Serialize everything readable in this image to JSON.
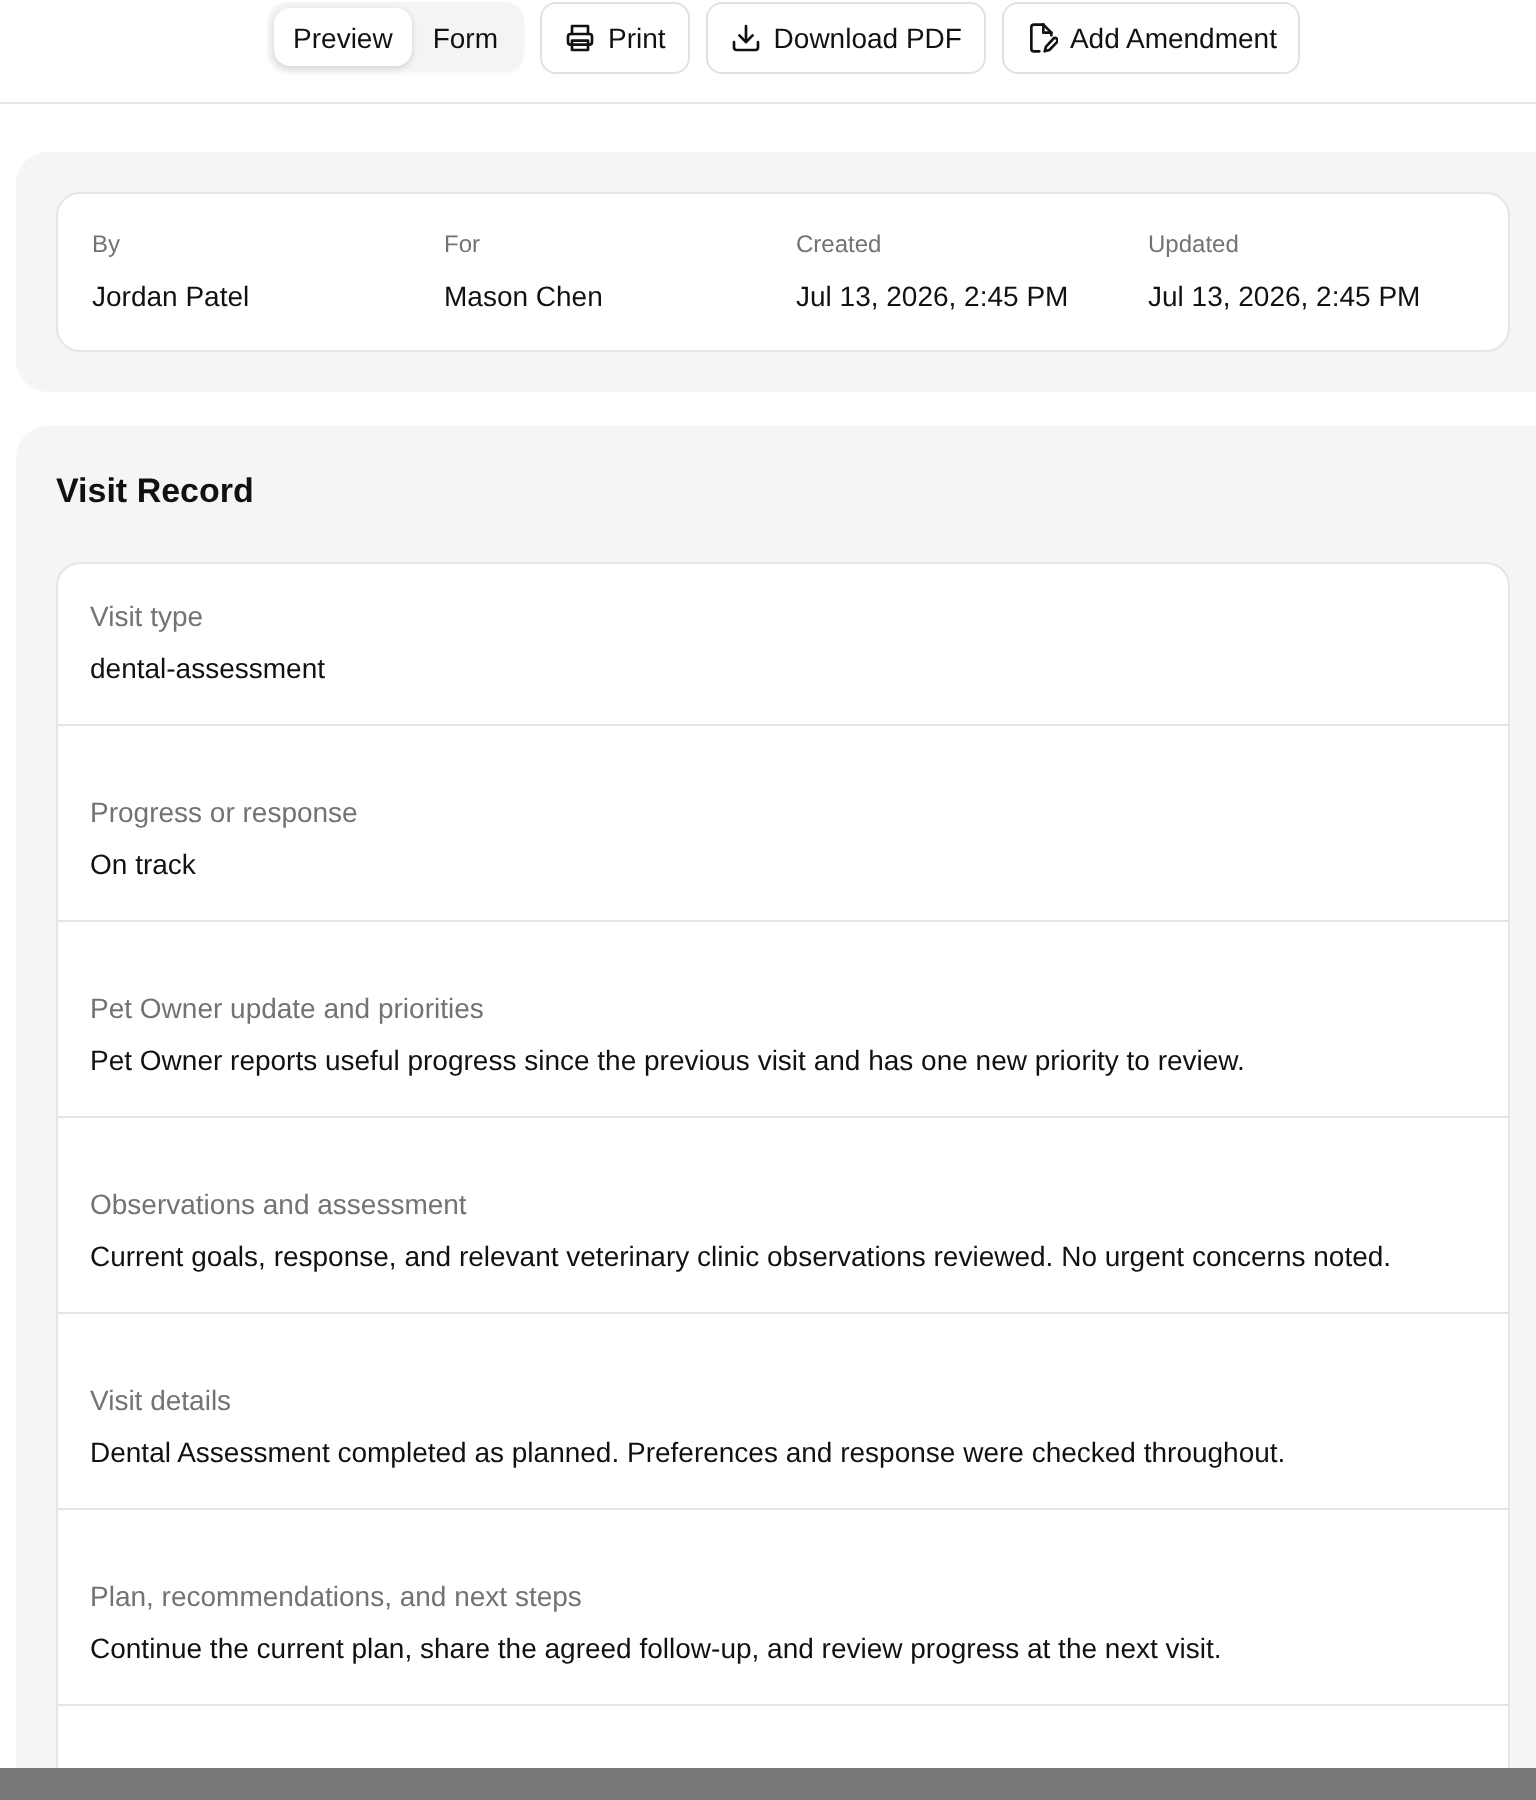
{
  "toolbar": {
    "view_toggle": [
      {
        "label": "Preview",
        "selected": true
      },
      {
        "label": "Form",
        "selected": false
      }
    ],
    "actions": [
      {
        "kind": "print",
        "label": "Print"
      },
      {
        "kind": "download",
        "label": "Download PDF"
      },
      {
        "kind": "amend",
        "label": "Add Amendment"
      }
    ]
  },
  "meta": [
    {
      "label": "By",
      "value": "Jordan Patel"
    },
    {
      "label": "For",
      "value": "Mason Chen"
    },
    {
      "label": "Created",
      "value": "Jul 13, 2026, 2:45 PM"
    },
    {
      "label": "Updated",
      "value": "Jul 13, 2026, 2:45 PM"
    }
  ],
  "record": {
    "title": "Visit Record",
    "fields": [
      {
        "label": "Visit type",
        "value": "dental-assessment"
      },
      {
        "label": "Progress or response",
        "value": "On track"
      },
      {
        "label": "Pet Owner update and priorities",
        "value": "Pet Owner reports useful progress since the previous visit and has one new priority to review."
      },
      {
        "label": "Observations and assessment",
        "value": "Current goals, response, and relevant veterinary clinic observations reviewed. No urgent concerns noted."
      },
      {
        "label": "Visit details",
        "value": "Dental Assessment completed as planned. Preferences and response were checked throughout."
      },
      {
        "label": "Plan, recommendations, and next steps",
        "value": "Continue the current plan, share the agreed follow-up, and review progress at the next visit."
      }
    ]
  }
}
